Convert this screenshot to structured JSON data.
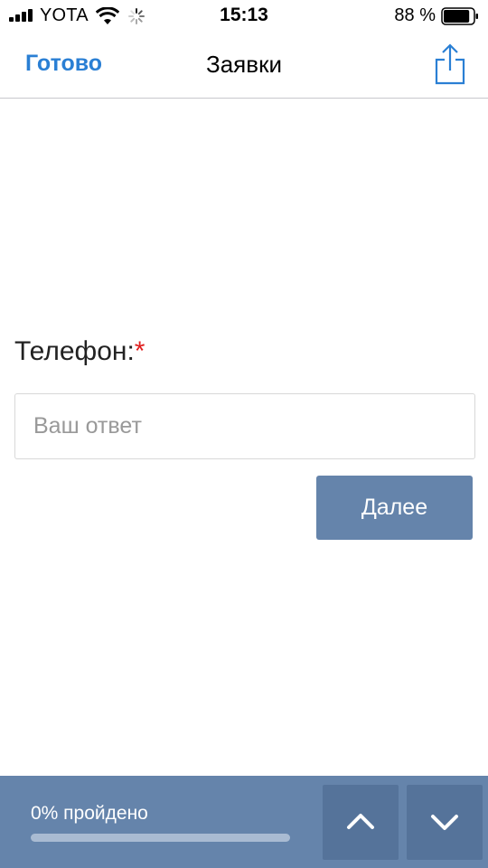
{
  "status_bar": {
    "carrier": "YOTA",
    "time": "15:13",
    "battery_percent": "88 %",
    "battery_level": 0.88
  },
  "nav": {
    "done_label": "Готово",
    "title": "Заявки",
    "share_icon": "share-icon"
  },
  "form": {
    "question_label": "Телефон:",
    "required_mark": "*",
    "answer_value": "",
    "answer_placeholder": "Ваш ответ",
    "next_label": "Далее"
  },
  "footer": {
    "progress_text": "0% пройдено",
    "progress_fraction": 0,
    "up_icon": "chevron-up-icon",
    "down_icon": "chevron-down-icon",
    "bar_color": "#6584ab",
    "accent_color": "#2a7fd4"
  }
}
